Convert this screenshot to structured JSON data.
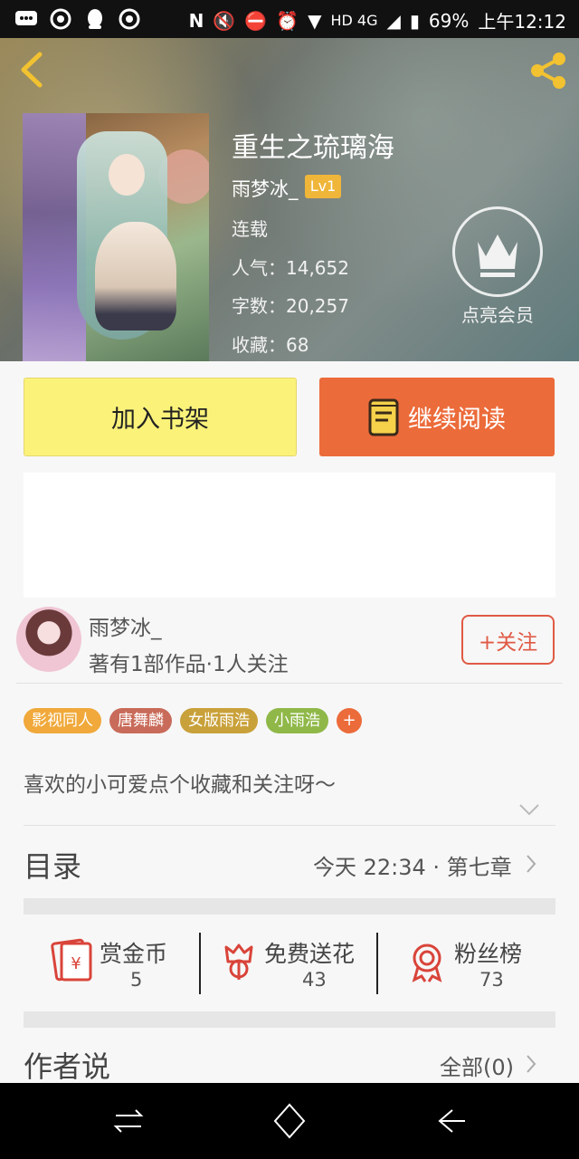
{
  "status_bar": {
    "battery": "69%",
    "time": "上午12:12",
    "network": "HD 4G",
    "icons": [
      "message-icon",
      "netease-icon",
      "qq-icon",
      "netease-icon",
      "nfc-icon",
      "mute-icon",
      "vibrate-off-icon",
      "alarm-icon",
      "wifi-icon",
      "signal-icon",
      "battery-icon"
    ]
  },
  "header": {
    "back_icon": "chevron-left-icon",
    "share_icon": "share-icon"
  },
  "book": {
    "title": "重生之琉璃海",
    "author": "雨梦冰_",
    "level": "Lv1",
    "status": "连载",
    "popularity": "人气：14,652",
    "word_count": "字数：20,257",
    "favorites": "收藏：68"
  },
  "vip": {
    "label": "点亮会员",
    "icon": "crown-icon"
  },
  "actions": {
    "add_shelf": "加入书架",
    "continue_read": "继续阅读"
  },
  "author_card": {
    "name": "雨梦冰_",
    "meta": "著有1部作品·1人关注",
    "follow": "+关注"
  },
  "tags": [
    {
      "label": "影视同人",
      "color": "#f0a93a"
    },
    {
      "label": "唐舞麟",
      "color": "#c96b5a"
    },
    {
      "label": "女版雨浩",
      "color": "#c9a13a"
    },
    {
      "label": "小雨浩",
      "color": "#8fb848"
    }
  ],
  "tag_plus": "+",
  "intro": "喜欢的小可爱点个收藏和关注呀～",
  "toc": {
    "title": "目录",
    "latest": "今天 22:34 · 第七章"
  },
  "stats": [
    {
      "label": "赏金币",
      "value": "5",
      "icon": "red-envelope-icon"
    },
    {
      "label": "免费送花",
      "value": "43",
      "icon": "flower-icon"
    },
    {
      "label": "粉丝榜",
      "value": "73",
      "icon": "medal-icon"
    }
  ],
  "author_say": {
    "title": "作者说",
    "all": "全部(0)"
  },
  "colors": {
    "accent_orange": "#ec6b3a",
    "shelf_yellow": "#fbf27a",
    "icon_red": "#d9443a",
    "badge_gold": "#f0b63a"
  }
}
